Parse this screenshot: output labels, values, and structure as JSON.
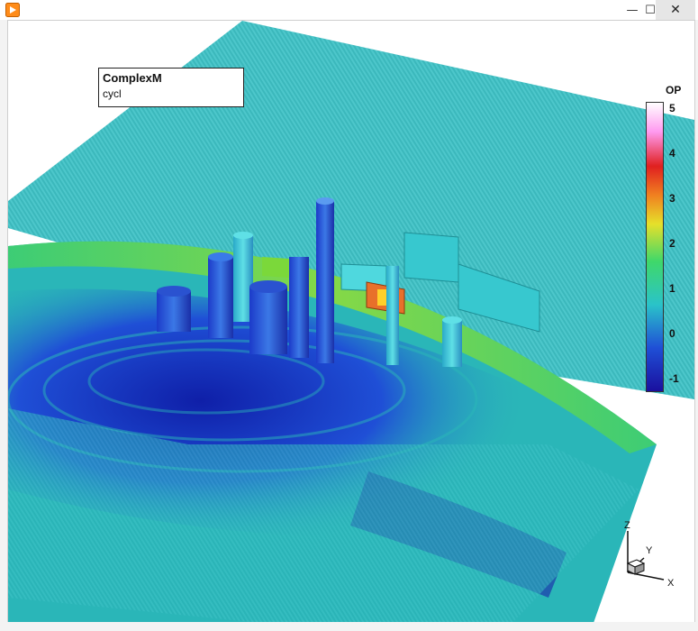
{
  "window": {
    "minimize_glyph": "—",
    "maximize_glyph": "☐",
    "close_glyph": "✕"
  },
  "plot": {
    "title": "ComplexM",
    "subtitle": "cycl"
  },
  "legend": {
    "variable": "OP",
    "ticks": [
      "5",
      "4",
      "3",
      "2",
      "1",
      "0",
      "-1"
    ],
    "colors": [
      "#1a0f9e",
      "#1f4fd6",
      "#2ac3c9",
      "#3fd86a",
      "#e6e02a",
      "#f08020",
      "#e02020",
      "#ff9af0",
      "#ffffff"
    ]
  },
  "axes": {
    "x": "X",
    "y": "Y",
    "z": "Z"
  },
  "colors": {
    "surface": "#2ab6b8",
    "low": "#1a2fbf",
    "mid": "#3fcf6e",
    "high": "#e8702a",
    "building": "#37c8cf"
  }
}
